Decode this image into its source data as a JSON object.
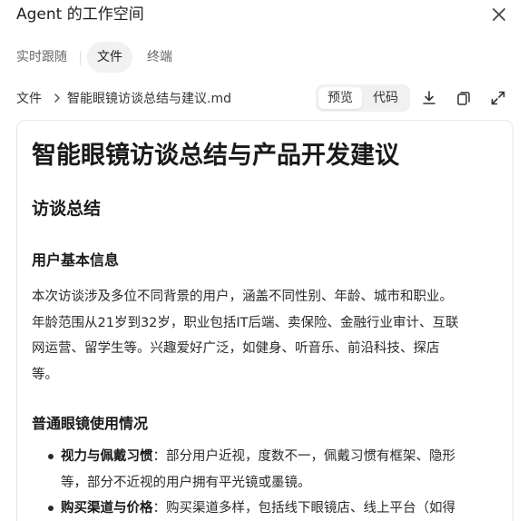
{
  "window": {
    "title": "Agent 的工作空间"
  },
  "tabs": [
    {
      "label": "实时跟随"
    },
    {
      "label": "文件"
    },
    {
      "label": "终端"
    }
  ],
  "active_tab": "文件",
  "path": {
    "root": "文件",
    "file": "智能眼镜访谈总结与建议.md"
  },
  "view_toggle": {
    "preview": "预览",
    "code": "代码",
    "selected": "预览"
  },
  "icons": [
    "close-icon",
    "chevron-right-icon",
    "download-icon",
    "copy-icon",
    "expand-icon"
  ],
  "document": {
    "title": "智能眼镜访谈总结与产品开发建议",
    "section": "访谈总结",
    "subsection1": "用户基本信息",
    "para_lines": [
      "本次访谈涉及多位不同背景的用户，涵盖不同性别、年龄、城市和职业。",
      "年龄范围从21岁到32岁，职业包括IT后端、卖保险、金融行业审计、互联",
      "网运营、留学生等。兴趣爱好广泛，如健身、听音乐、前沿科技、探店",
      "等。"
    ],
    "subsection2": "普通眼镜使用情况",
    "list": [
      {
        "label": "视力与佩戴习惯",
        "line1": "：部分用户近视，度数不一，佩戴习惯有框架、隐形",
        "line2": "等，部分不近视的用户拥有平光镜或墨镜。"
      },
      {
        "label": "购买渠道与价格",
        "line1": "：购买渠道多样，包括线下眼镜店、线上平台（如得",
        "line2": ""
      }
    ]
  }
}
